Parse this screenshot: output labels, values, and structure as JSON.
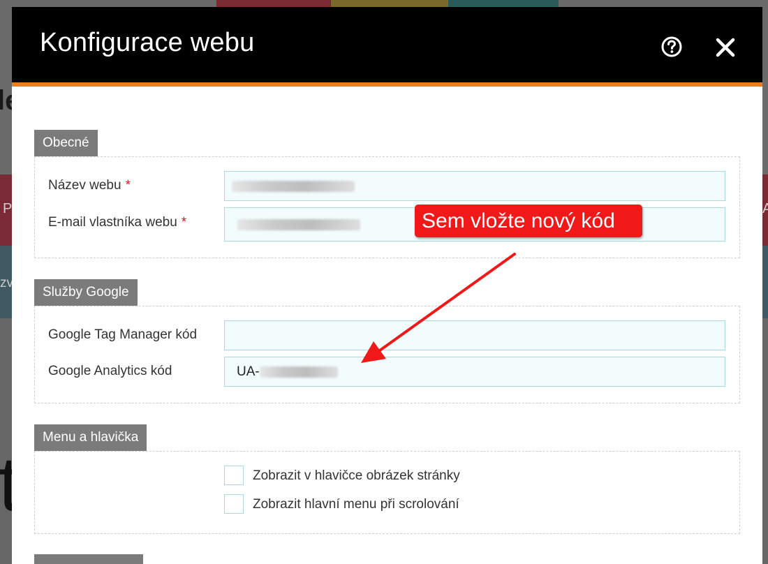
{
  "background": {
    "heading_fragment": "le",
    "band1_fragment": "P",
    "band1_fragment_right": "A",
    "band2_fragment": "zv",
    "big_fragment": "t"
  },
  "modal": {
    "title": "Konfigurace webu",
    "help_icon": "question-circle-icon",
    "close_icon": "close-x-icon"
  },
  "sections": {
    "general": {
      "tab_label": "Obecné",
      "site_name_label": "Název webu",
      "owner_email_label": "E-mail vlastníka webu",
      "required_mark": "*"
    },
    "google": {
      "tab_label": "Služby Google",
      "gtm_label": "Google Tag Manager kód",
      "gtm_value": "",
      "ga_label": "Google Analytics kód",
      "ga_value_prefix": "UA-"
    },
    "menu": {
      "tab_label": "Menu a hlavička",
      "show_header_image_label": "Zobrazit v hlavičce obrázek stránky",
      "show_header_image_checked": false,
      "show_menu_scroll_label": "Zobrazit hlavní menu při scrolování",
      "show_menu_scroll_checked": false
    }
  },
  "annotation": {
    "callout_text": "Sem vložte nový kód"
  },
  "colors": {
    "header": "#000000",
    "accent": "#f07d1a",
    "section_tab": "#7b7b7b",
    "input_bg": "#f2fcfd",
    "input_border": "#a9d9e2",
    "required": "#e0202a",
    "callout": "#f01818"
  }
}
